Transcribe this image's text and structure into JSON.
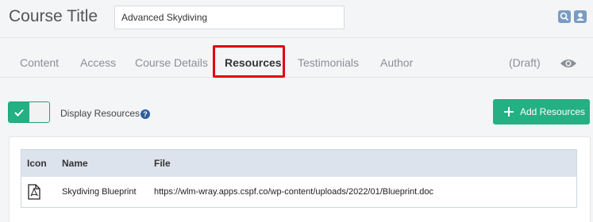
{
  "header": {
    "label": "Course Title",
    "title_value": "Advanced Skydiving",
    "search_icon": "search-icon",
    "user_icon": "user-icon"
  },
  "tabs": [
    {
      "label": "Content"
    },
    {
      "label": "Access"
    },
    {
      "label": "Course Details"
    },
    {
      "label": "Resources",
      "active": true
    },
    {
      "label": "Testimonials"
    },
    {
      "label": "Author"
    },
    {
      "label": "(Draft)"
    }
  ],
  "resources": {
    "toggle_state": "on",
    "display_label": "Display Resources",
    "help": "?",
    "add_button": "Add Resources"
  },
  "table": {
    "columns": [
      "Icon",
      "Name",
      "File"
    ],
    "rows": [
      {
        "icon": "pdf-icon",
        "name": "Skydiving Blueprint",
        "file": "https://wlm-wray.apps.cspf.co/wp-content/uploads/2022/01/Blueprint.doc"
      }
    ]
  },
  "colors": {
    "accent_green": "#23b083",
    "highlight_red": "#e00012",
    "header_blue": "#7a9cc2"
  }
}
